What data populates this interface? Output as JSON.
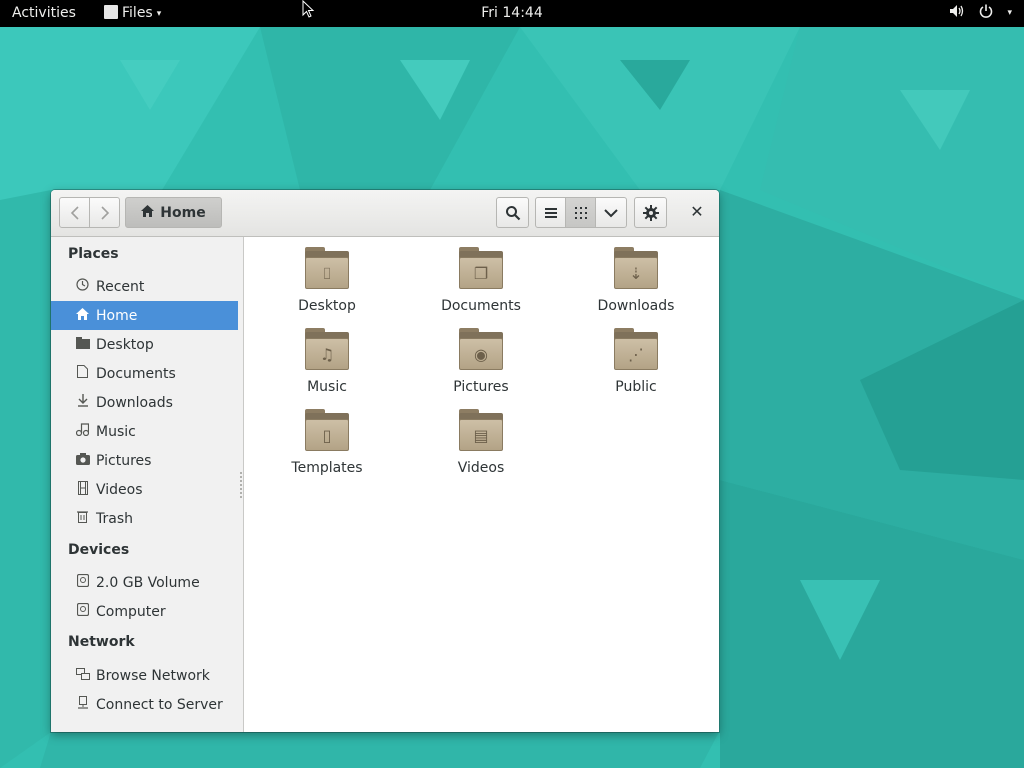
{
  "topbar": {
    "activities": "Activities",
    "app_menu": "Files",
    "app_menu_arrow": "▾",
    "clock": "Fri 14:44",
    "volume_icon": "volume-icon",
    "power_icon": "power-icon",
    "power_arrow": "▾"
  },
  "toolbar": {
    "back_icon": "chevron-left-icon",
    "forward_icon": "chevron-right-icon",
    "path_label": "Home",
    "search_icon": "search-icon",
    "list_view_icon": "list-view-icon",
    "grid_view_icon": "grid-view-icon",
    "view_menu_icon": "chevron-down-icon",
    "gear_icon": "gear-icon",
    "close_label": "✕"
  },
  "sidebar": {
    "places_heading": "Places",
    "places": [
      {
        "label": "Recent",
        "icon": "clock-icon"
      },
      {
        "label": "Home",
        "icon": "home-icon",
        "selected": true
      },
      {
        "label": "Desktop",
        "icon": "desktop-folder-icon"
      },
      {
        "label": "Documents",
        "icon": "document-icon"
      },
      {
        "label": "Downloads",
        "icon": "download-icon"
      },
      {
        "label": "Music",
        "icon": "music-icon"
      },
      {
        "label": "Pictures",
        "icon": "camera-icon"
      },
      {
        "label": "Videos",
        "icon": "film-icon"
      },
      {
        "label": "Trash",
        "icon": "trash-icon"
      }
    ],
    "devices_heading": "Devices",
    "devices": [
      {
        "label": "2.0 GB Volume",
        "icon": "drive-icon"
      },
      {
        "label": "Computer",
        "icon": "drive-icon"
      }
    ],
    "network_heading": "Network",
    "network": [
      {
        "label": "Browse Network",
        "icon": "network-icon"
      },
      {
        "label": "Connect to Server",
        "icon": "server-icon"
      }
    ]
  },
  "files": [
    {
      "label": "Desktop",
      "icon": "desktop-folder-icon"
    },
    {
      "label": "Documents",
      "icon": "documents-folder-icon"
    },
    {
      "label": "Downloads",
      "icon": "downloads-folder-icon"
    },
    {
      "label": "Music",
      "icon": "music-folder-icon"
    },
    {
      "label": "Pictures",
      "icon": "pictures-folder-icon"
    },
    {
      "label": "Public",
      "icon": "public-folder-icon"
    },
    {
      "label": "Templates",
      "icon": "templates-folder-icon"
    },
    {
      "label": "Videos",
      "icon": "videos-folder-icon"
    }
  ],
  "colors": {
    "topbar": "#000000",
    "desktop": "#33bfb1",
    "selection": "#4a90d9",
    "folder": "#b3a386"
  }
}
